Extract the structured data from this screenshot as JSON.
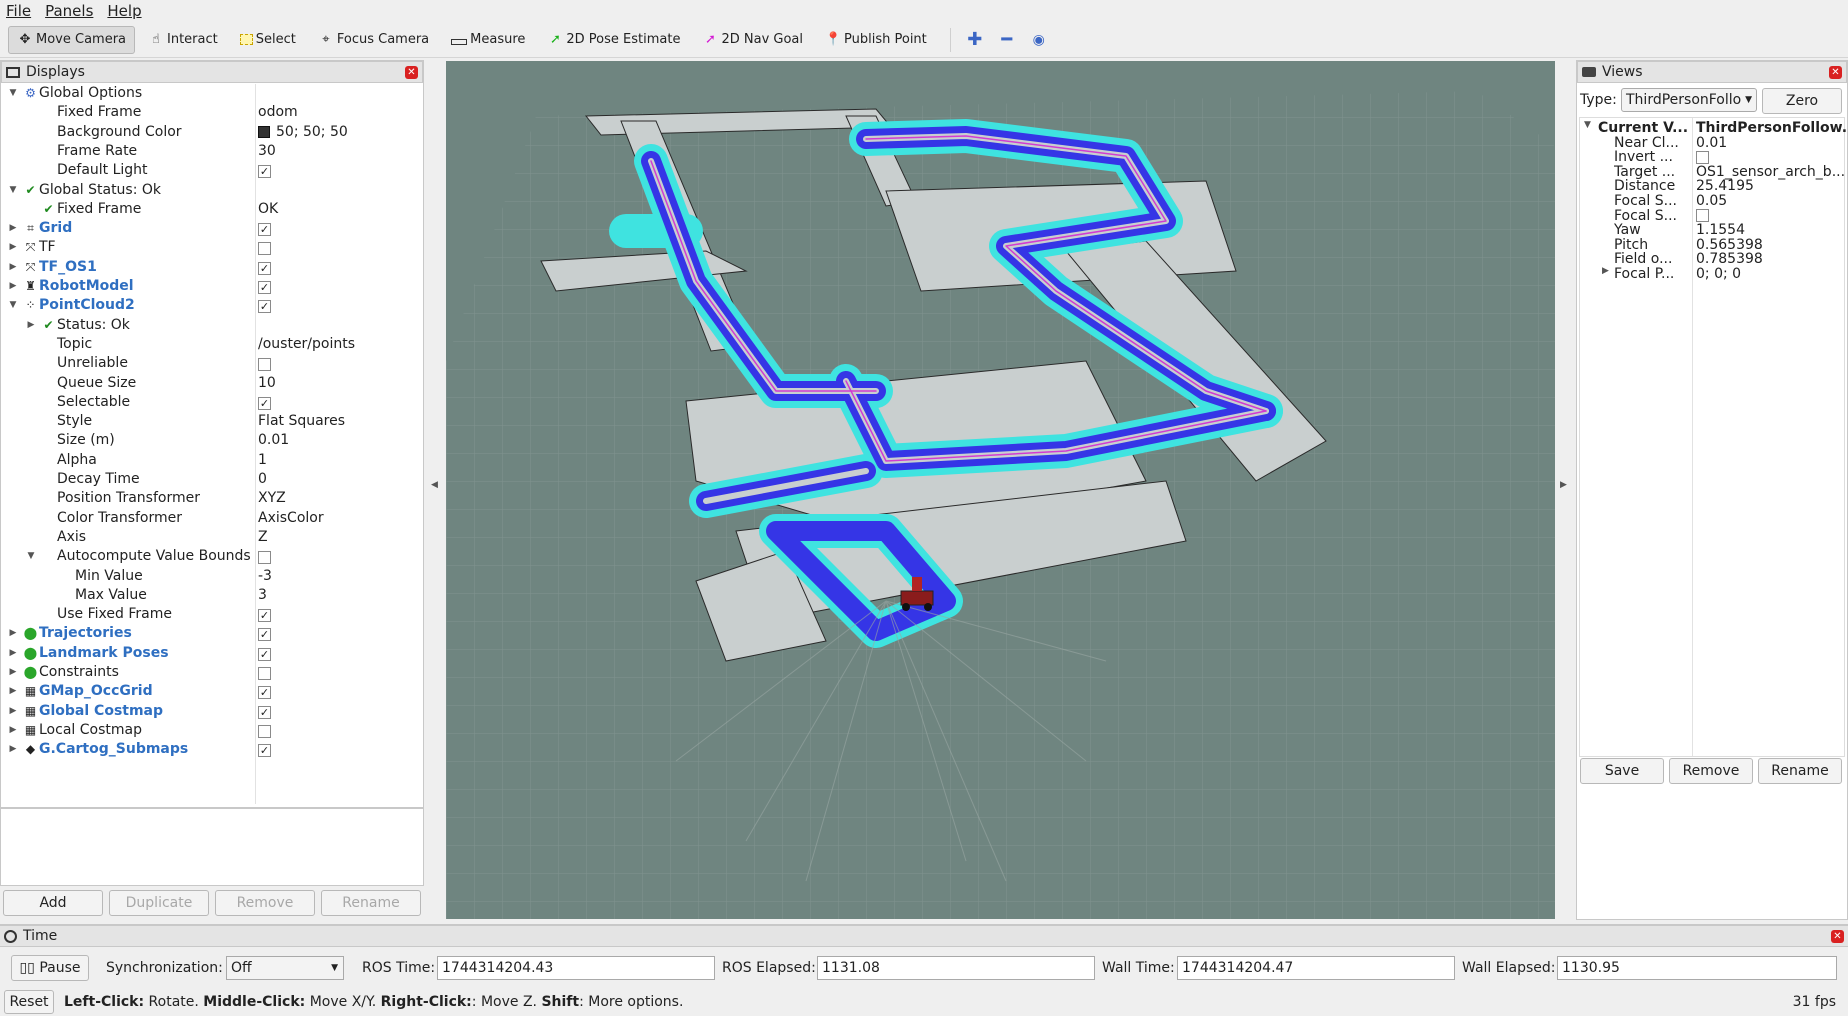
{
  "menu": [
    "File",
    "Panels",
    "Help"
  ],
  "toolbar": {
    "tools": [
      {
        "label": "Move Camera",
        "icon": "move-camera-icon",
        "active": true
      },
      {
        "label": "Interact",
        "icon": "hand-pointer-icon"
      },
      {
        "label": "Select",
        "icon": "select-box-icon"
      },
      {
        "label": "Focus Camera",
        "icon": "crosshair-icon"
      },
      {
        "label": "Measure",
        "icon": "ruler-icon"
      },
      {
        "label": "2D Pose Estimate",
        "icon": "green-arrow-icon"
      },
      {
        "label": "2D Nav Goal",
        "icon": "magenta-arrow-icon"
      },
      {
        "label": "Publish Point",
        "icon": "map-pin-icon"
      }
    ]
  },
  "displays": {
    "title": "Displays",
    "rows": [
      {
        "label": "Global Options",
        "value": "",
        "indent": 0,
        "arrow": "open",
        "icon": "gear"
      },
      {
        "label": "Fixed Frame",
        "value": "odom",
        "indent": 1
      },
      {
        "label": "Background Color",
        "value": "50; 50; 50",
        "indent": 1,
        "swatch": true
      },
      {
        "label": "Frame Rate",
        "value": "30",
        "indent": 1
      },
      {
        "label": "Default Light",
        "value": "check",
        "indent": 1
      },
      {
        "label": "Global Status: Ok",
        "value": "",
        "indent": 0,
        "arrow": "open",
        "icon": "ok"
      },
      {
        "label": "Fixed Frame",
        "value": "OK",
        "indent": 1,
        "icon": "ok"
      },
      {
        "label": "Grid",
        "value": "check",
        "indent": 0,
        "arrow": "closed",
        "icon": "grid",
        "blue": true
      },
      {
        "label": "TF",
        "value": "uncheck",
        "indent": 0,
        "arrow": "closed",
        "icon": "tf"
      },
      {
        "label": "TF_OS1",
        "value": "check",
        "indent": 0,
        "arrow": "closed",
        "icon": "tf",
        "blue": true
      },
      {
        "label": "RobotModel",
        "value": "check",
        "indent": 0,
        "arrow": "closed",
        "icon": "robot",
        "blue": true
      },
      {
        "label": "PointCloud2",
        "value": "check",
        "indent": 0,
        "arrow": "open",
        "icon": "cloud",
        "blue": true
      },
      {
        "label": "Status: Ok",
        "value": "",
        "indent": 1,
        "arrow": "closed",
        "icon": "ok"
      },
      {
        "label": "Topic",
        "value": "/ouster/points",
        "indent": 1
      },
      {
        "label": "Unreliable",
        "value": "uncheck",
        "indent": 1
      },
      {
        "label": "Queue Size",
        "value": "10",
        "indent": 1
      },
      {
        "label": "Selectable",
        "value": "check",
        "indent": 1
      },
      {
        "label": "Style",
        "value": "Flat Squares",
        "indent": 1
      },
      {
        "label": "Size (m)",
        "value": "0.01",
        "indent": 1
      },
      {
        "label": "Alpha",
        "value": "1",
        "indent": 1
      },
      {
        "label": "Decay Time",
        "value": "0",
        "indent": 1
      },
      {
        "label": "Position Transformer",
        "value": "XYZ",
        "indent": 1
      },
      {
        "label": "Color Transformer",
        "value": "AxisColor",
        "indent": 1
      },
      {
        "label": "Axis",
        "value": "Z",
        "indent": 1
      },
      {
        "label": "Autocompute Value Bounds",
        "value": "uncheck",
        "indent": 1,
        "arrow": "open"
      },
      {
        "label": "Min Value",
        "value": "-3",
        "indent": 2
      },
      {
        "label": "Max Value",
        "value": "3",
        "indent": 2
      },
      {
        "label": "Use Fixed Frame",
        "value": "check",
        "indent": 1
      },
      {
        "label": "Trajectories",
        "value": "check",
        "indent": 0,
        "arrow": "closed",
        "icon": "markers",
        "blue": true
      },
      {
        "label": "Landmark Poses",
        "value": "check",
        "indent": 0,
        "arrow": "closed",
        "icon": "markers",
        "blue": true
      },
      {
        "label": "Constraints",
        "value": "uncheck",
        "indent": 0,
        "arrow": "closed",
        "icon": "markers"
      },
      {
        "label": "GMap_OccGrid",
        "value": "check",
        "indent": 0,
        "arrow": "closed",
        "icon": "map",
        "blue": true
      },
      {
        "label": "Global Costmap",
        "value": "check",
        "indent": 0,
        "arrow": "closed",
        "icon": "map",
        "blue": true
      },
      {
        "label": "Local Costmap",
        "value": "uncheck",
        "indent": 0,
        "arrow": "closed",
        "icon": "map"
      },
      {
        "label": "G.Cartog_Submaps",
        "value": "check",
        "indent": 0,
        "arrow": "closed",
        "icon": "diamond",
        "blue": true
      }
    ],
    "buttons": {
      "add": "Add",
      "duplicate": "Duplicate",
      "remove": "Remove",
      "rename": "Rename"
    }
  },
  "views": {
    "title": "Views",
    "type_label": "Type:",
    "type_value": "ThirdPersonFollo",
    "zero": "Zero",
    "rows": [
      {
        "label": "Current V...",
        "value": "ThirdPersonFollow...",
        "bold": true,
        "arrow": "open"
      },
      {
        "label": "Near Cl...",
        "value": "0.01"
      },
      {
        "label": "Invert ...",
        "value": "uncheck"
      },
      {
        "label": "Target ...",
        "value": "OS1_sensor_arch_b..."
      },
      {
        "label": "Distance",
        "value": "25.4195"
      },
      {
        "label": "Focal S...",
        "value": "0.05"
      },
      {
        "label": "Focal S...",
        "value": "uncheck"
      },
      {
        "label": "Yaw",
        "value": "1.1554"
      },
      {
        "label": "Pitch",
        "value": "0.565398"
      },
      {
        "label": "Field o...",
        "value": "0.785398"
      },
      {
        "label": "Focal P...",
        "value": "0; 0; 0",
        "arrow": "closed"
      }
    ],
    "buttons": {
      "save": "Save",
      "remove": "Remove",
      "rename": "Rename"
    }
  },
  "time": {
    "title": "Time",
    "pause": "Pause",
    "sync_label": "Synchronization:",
    "sync_value": "Off",
    "ros_time_label": "ROS Time:",
    "ros_time": "1744314204.43",
    "ros_elapsed_label": "ROS Elapsed:",
    "ros_elapsed": "1131.08",
    "wall_time_label": "Wall Time:",
    "wall_time": "1744314204.47",
    "wall_elapsed_label": "Wall Elapsed:",
    "wall_elapsed": "1130.95"
  },
  "status": {
    "reset": "Reset",
    "b1": "Left-Click:",
    "t1": " Rotate. ",
    "b2": "Middle-Click:",
    "t2": " Move X/Y. ",
    "b3": "Right-Click:",
    "t3": ": Move Z. ",
    "b4": "Shift",
    "t4": ": More options.",
    "fps": "31 fps"
  },
  "colors": {
    "viewport_bg": "#6f8580",
    "costmap_cyan": "#3fe3e0",
    "costmap_blue": "#3535e6",
    "free_space": "#c9cfcf"
  }
}
